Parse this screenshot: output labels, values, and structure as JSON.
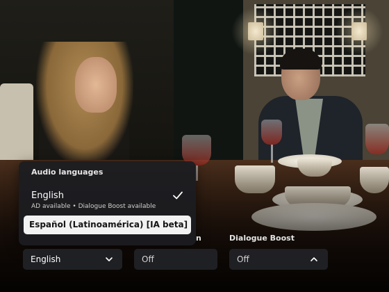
{
  "audio_menu": {
    "title": "Audio languages",
    "options": [
      {
        "label": "English",
        "sublabel": "AD available • Dialogue Boost available",
        "selected": true
      },
      {
        "label": "Español (Latinoamérica) [IA beta]",
        "sublabel": "",
        "focused": true
      }
    ]
  },
  "controls": {
    "audio_language": {
      "value": "English",
      "icon": "chevron-down-icon"
    },
    "subtitles": {
      "label_fragment": "n",
      "value": "Off"
    },
    "dialogue_boost": {
      "label": "Dialogue Boost",
      "value": "Off",
      "icon": "chevron-up-icon"
    }
  },
  "colors": {
    "menu_bg": "#1c1d21",
    "focused_option_bg": "#f2f2f2",
    "dropdown_bg": "#222327"
  }
}
